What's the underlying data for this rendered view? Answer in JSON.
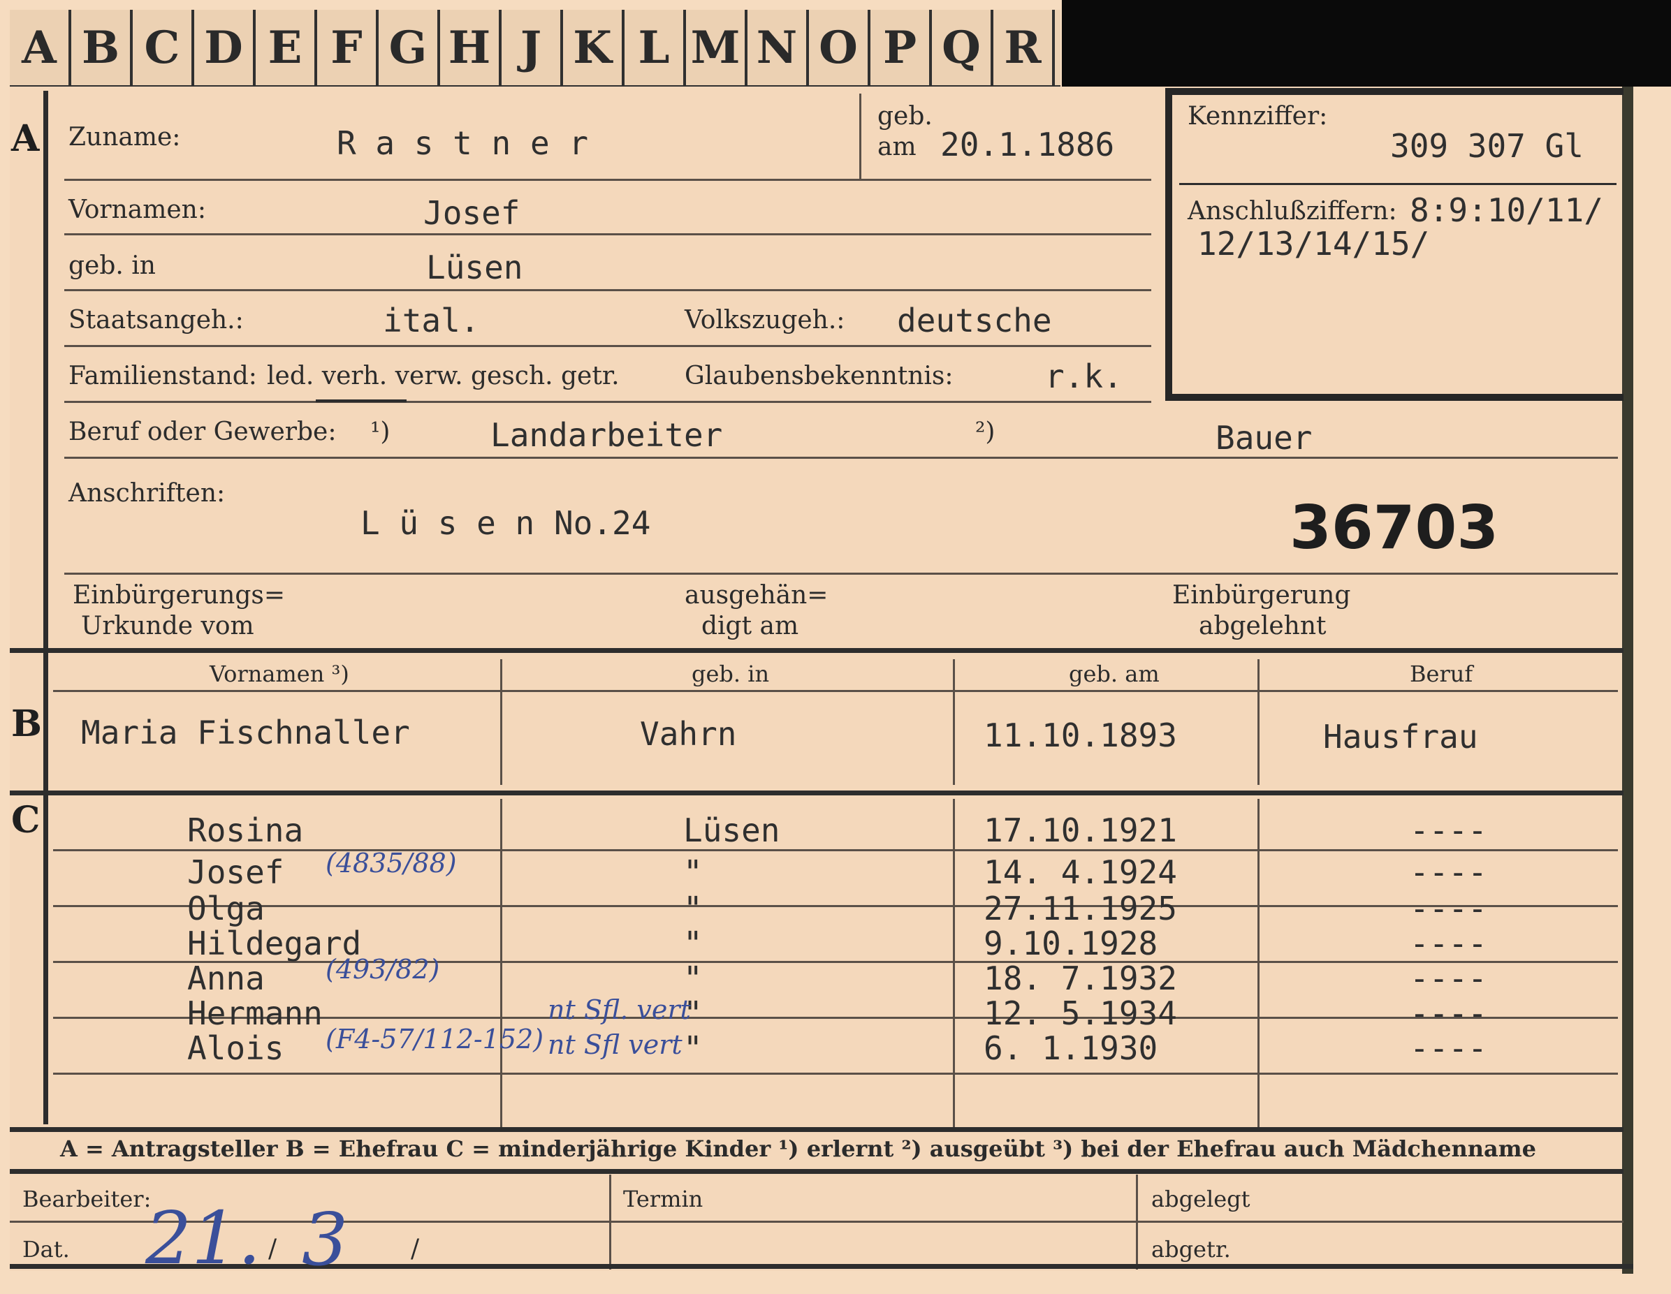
{
  "tabs": [
    "A",
    "B",
    "C",
    "D",
    "E",
    "F",
    "G",
    "H",
    "J",
    "K",
    "L",
    "M",
    "N",
    "O",
    "P",
    "Q",
    "R"
  ],
  "section_a": {
    "marker": "A",
    "zuname_label": "Zuname:",
    "zuname": "R a s t n e r",
    "geb_label_1": "geb.",
    "geb_label_2": "am",
    "geb_am": "20.1.1886",
    "kennziffer_label": "Kennziffer:",
    "kennziffer": "309 307  Gl",
    "anschluss_label": "Anschlußziffern:",
    "anschluss_1": "8:9:10/11/",
    "anschluss_2": "12/13/14/15/",
    "vornamen_label": "Vornamen:",
    "vornamen": "Josef",
    "gebin_label": "geb. in",
    "gebin": "Lüsen",
    "staat_label": "Staatsangeh.:",
    "staat": "ital.",
    "volk_label": "Volkszugeh.:",
    "volk": "deutsche",
    "familienstand_label": "Familienstand:",
    "familienstand_options": "led.  verh.  verw.  gesch.  getr.",
    "glauben_label": "Glaubensbekenntnis:",
    "glauben": "r.k.",
    "beruf_label": "Beruf oder Gewerbe:",
    "beruf_mark_1": "¹)",
    "beruf_1": "Landarbeiter",
    "beruf_mark_2": "²)",
    "beruf_2": "Bauer",
    "anschriften_label": "Anschriften:",
    "anschrift": "L ü s e n  No.24",
    "stamp_number": "36703",
    "einb_label_1": "Einbürgerungs=",
    "einb_label_2": "Urkunde vom",
    "ausg_label_1": "ausgehän=",
    "ausg_label_2": "digt am",
    "abgel_label_1": "Einbürgerung",
    "abgel_label_2": "abgelehnt"
  },
  "section_b": {
    "marker": "B",
    "headers": [
      "Vornamen ³)",
      "geb. in",
      "geb. am",
      "Beruf"
    ],
    "row": [
      "Maria Fischnaller",
      "Vahrn",
      "11.10.1893",
      "Hausfrau"
    ]
  },
  "section_c": {
    "marker": "C",
    "children": [
      {
        "name": "Rosina",
        "place": "Lüsen",
        "date": "17.10.1921",
        "beruf": "----",
        "note": "",
        "place_note": ""
      },
      {
        "name": "Josef",
        "place": "\"",
        "date": "14. 4.1924",
        "beruf": "----",
        "note": "(4835/88)",
        "place_note": ""
      },
      {
        "name": "Olga",
        "place": "\"",
        "date": "27.11.1925",
        "beruf": "----",
        "note": "",
        "place_note": ""
      },
      {
        "name": "Hildegard",
        "place": "\"",
        "date": "9.10.1928",
        "beruf": "----",
        "note": "",
        "place_note": ""
      },
      {
        "name": "Anna",
        "place": "\"",
        "date": "18. 7.1932",
        "beruf": "----",
        "note": "(493/82)",
        "place_note": ""
      },
      {
        "name": "Hermann",
        "place": "\"",
        "date": "12. 5.1934",
        "beruf": "----",
        "note": "",
        "place_note": "nt Sfl. vert"
      },
      {
        "name": "Alois",
        "place": "\"",
        "date": "6. 1.1930",
        "beruf": "----",
        "note": "(F4-57/112-152)",
        "place_note": "nt Sfl vert"
      }
    ]
  },
  "legend": "A = Antragsteller   B = Ehefrau   C = minderjährige Kinder   ¹) erlernt   ²) ausgeübt   ³) bei der Ehefrau auch Mädchenname",
  "footer": {
    "bearbeiter_label": "Bearbeiter:",
    "termin_label": "Termin",
    "abgelegt_label": "abgelegt",
    "dat_label": "Dat.",
    "dat_day": "21.",
    "dat_month": "3",
    "slash_1": "/",
    "slash_2": "/",
    "abgetr_label": "abgetr."
  }
}
